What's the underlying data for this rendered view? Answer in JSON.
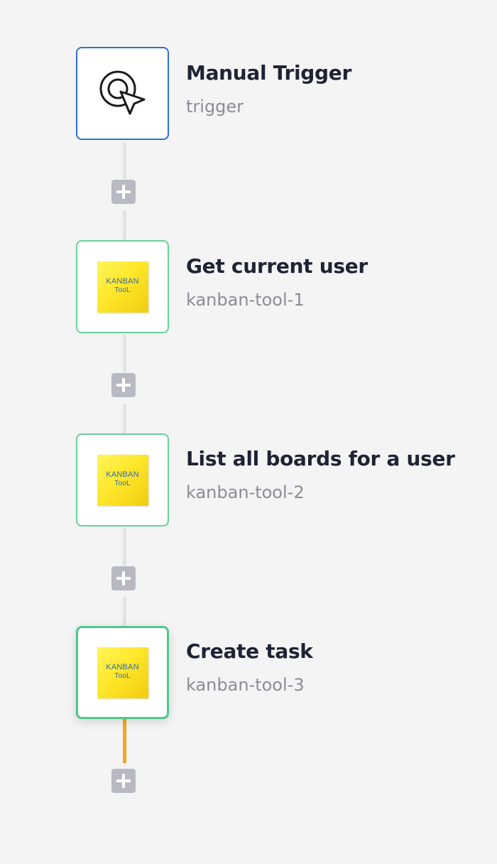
{
  "workflow": {
    "steps": [
      {
        "title": "Manual Trigger",
        "subtitle": "trigger",
        "icon": "cursor-click-icon",
        "type": "trigger"
      },
      {
        "title": "Get current user",
        "subtitle": "kanban-tool-1",
        "icon": "kanban-tool-logo",
        "type": "action",
        "logo_text": [
          "KANBAN",
          "TooL"
        ]
      },
      {
        "title": "List all boards for a user",
        "subtitle": "kanban-tool-2",
        "icon": "kanban-tool-logo",
        "type": "action",
        "logo_text": [
          "KANBAN",
          "TooL"
        ]
      },
      {
        "title": "Create task",
        "subtitle": "kanban-tool-3",
        "icon": "kanban-tool-logo",
        "type": "action",
        "selected": true,
        "logo_text": [
          "KANBAN",
          "TooL"
        ]
      }
    ],
    "colors": {
      "trigger_border": "#2e6fd8",
      "action_border": "#6bcf99",
      "selected_border": "#4ec88b",
      "connector": "#e3e3e5",
      "active_connector": "#f5a623",
      "add_button": "#b9b9c3",
      "background": "#f4f4f4"
    }
  }
}
